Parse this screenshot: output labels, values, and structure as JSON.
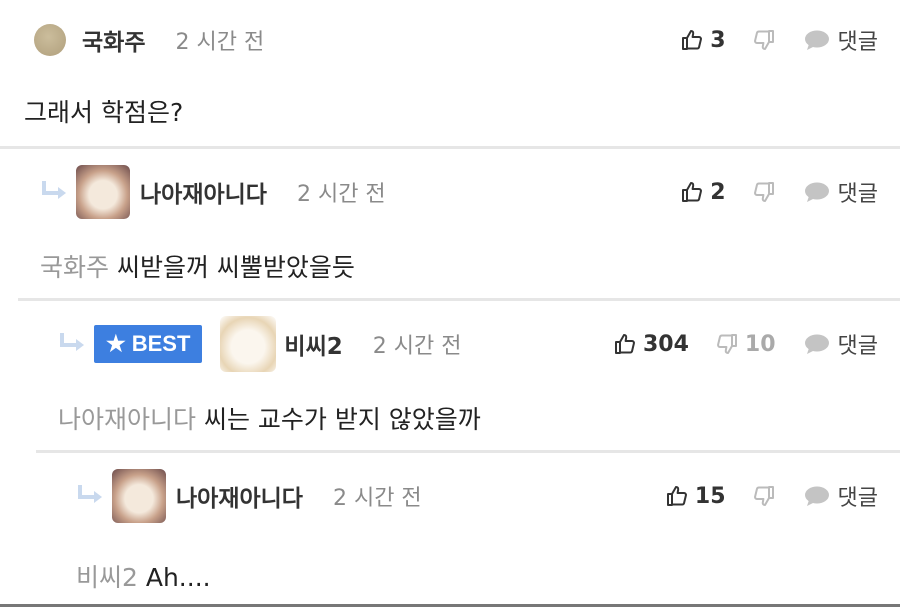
{
  "comments": [
    {
      "author": "국화주",
      "time": "2 시간 전",
      "text": "그래서 학점은?",
      "likes": "3",
      "reply_label": "댓글"
    },
    {
      "author": "나아재아니다",
      "time": "2 시간 전",
      "mention": "국화주",
      "text": "씨받을꺼 씨뿔받았을듯",
      "likes": "2",
      "reply_label": "댓글"
    },
    {
      "badge": "BEST",
      "author": "비씨2",
      "time": "2 시간 전",
      "mention": "나아재아니다",
      "text": "씨는 교수가 받지 않았을까",
      "likes": "304",
      "dislikes": "10",
      "reply_label": "댓글"
    },
    {
      "author": "나아재아니다",
      "time": "2 시간 전",
      "mention": "비씨2",
      "text": "Ah....",
      "likes": "15",
      "reply_label": "댓글"
    }
  ],
  "colors": {
    "best_badge": "#3d7fe0",
    "mention": "#999999",
    "time": "#8a8a8a",
    "divider": "#e6e6e6"
  },
  "icons": [
    "thumbs-up-icon",
    "thumbs-down-icon",
    "speech-bubble-icon",
    "reply-arrow-icon",
    "star-icon"
  ]
}
